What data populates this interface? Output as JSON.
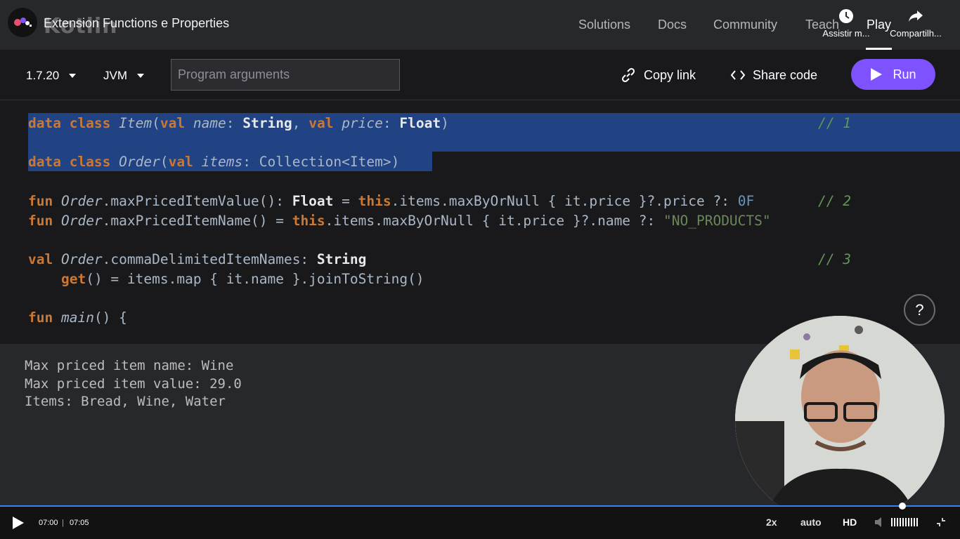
{
  "header": {
    "logo_text": "Kotlin",
    "video_title": "Extension Functions e Properties",
    "nav": [
      "Solutions",
      "Docs",
      "Community",
      "Teach",
      "Play"
    ],
    "watch_later_label": "Assistir m...",
    "share_label": "Compartilh..."
  },
  "toolbar": {
    "version": "1.7.20",
    "target": "JVM",
    "args_placeholder": "Program arguments",
    "copy_link": "Copy link",
    "share_code": "Share code",
    "run": "Run"
  },
  "code": {
    "l1": {
      "k1": "data class ",
      "n": "Item",
      "p1": "(",
      "k2": "val ",
      "a1": "name",
      "c1": ": ",
      "t1": "String",
      "s1": ", ",
      "k3": "val ",
      "a2": "price",
      "c2": ": ",
      "t2": "Float",
      "e": ")"
    },
    "l2": {
      "k1": "data class ",
      "n": "Order",
      "p1": "(",
      "k2": "val ",
      "a1": "items",
      "rest": ": Collection<Item>)"
    },
    "l3": {
      "k1": "fun ",
      "n": "Order",
      "m": ".maxPricedItemValue(): ",
      "t": "Float",
      "eq": " = ",
      "k2": "this",
      "rest": ".items.maxByOrNull { it.price }?.price ?: ",
      "num": "0F"
    },
    "l4": {
      "k1": "fun ",
      "n": "Order",
      "m": ".maxPricedItemName() = ",
      "k2": "this",
      "rest": ".items.maxByOrNull { it.price }?.name ?: ",
      "str": "\"NO_PRODUCTS\""
    },
    "l5": {
      "k1": "val ",
      "n": "Order",
      "m": ".commaDelimitedItemNames: ",
      "t": "String"
    },
    "l6": {
      "ind": "    ",
      "k1": "get",
      "rest": "() = items.map { it.name }.joinToString()"
    },
    "l7": {
      "k1": "fun ",
      "n": "main",
      "rest": "() {"
    },
    "comments": [
      "// 1",
      "// 2",
      "// 3"
    ]
  },
  "help_label": "?",
  "output": [
    "Max priced item name: Wine",
    "Max priced item value: 29.0",
    "Items: Bread, Wine, Water"
  ],
  "player": {
    "current_time": "07:00",
    "separator": "|",
    "duration": "07:05",
    "speed": "2x",
    "quality": "auto",
    "hd": "HD",
    "progress_fraction": 0.988
  }
}
